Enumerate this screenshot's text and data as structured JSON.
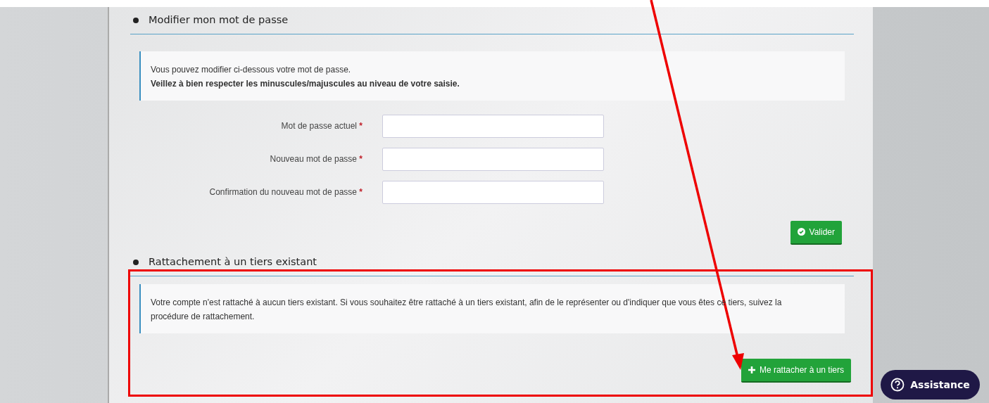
{
  "password_section": {
    "title": "Modifier mon mot de passe",
    "info": "Vous pouvez modifier ci-dessous votre mot de passe.",
    "info_bold": "Veillez à bien respecter les minuscules/majuscules au niveau de votre saisie.",
    "fields": [
      {
        "label": "Mot de passe actuel",
        "required_mark": "*"
      },
      {
        "label": "Nouveau mot de passe",
        "required_mark": "*"
      },
      {
        "label": "Confirmation du nouveau mot de passe",
        "required_mark": "*"
      }
    ],
    "submit_button": "Valider"
  },
  "attachment_section": {
    "title": "Rattachement à un tiers existant",
    "info": "Votre compte n'est rattaché à aucun tiers existant. Si vous souhaitez être rattaché à un tiers existant, afin de le représenter ou d'indiquer que vous êtes ce tiers, suivez la procédure de rattachement.",
    "button": "Me rattacher à un tiers"
  },
  "assistance_button": "Assistance"
}
